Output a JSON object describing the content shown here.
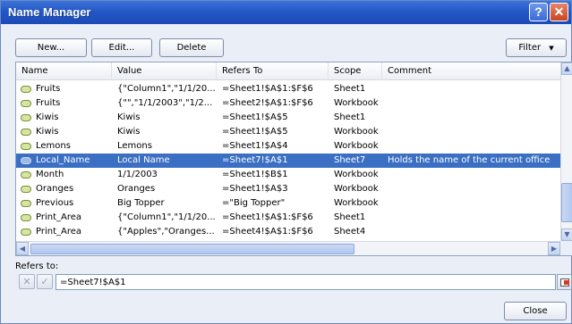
{
  "window": {
    "title": "Name Manager"
  },
  "toolbar": {
    "new_label": "New...",
    "edit_label": "Edit...",
    "delete_label": "Delete",
    "filter_label": "Filter"
  },
  "table": {
    "headers": {
      "name": "Name",
      "value": "Value",
      "refers_to": "Refers To",
      "scope": "Scope",
      "comment": "Comment"
    },
    "rows": [
      {
        "name": "Fruits",
        "value": "{\"Column1\",\"1/1/20...",
        "refers_to": "=Sheet1!$A$1:$F$6",
        "scope": "Sheet1",
        "comment": ""
      },
      {
        "name": "Fruits",
        "value": "{\"\",\"1/1/2003\",\"1/2...",
        "refers_to": "=Sheet2!$A$1:$F$6",
        "scope": "Workbook",
        "comment": ""
      },
      {
        "name": "Kiwis",
        "value": "Kiwis",
        "refers_to": "=Sheet1!$A$5",
        "scope": "Sheet1",
        "comment": ""
      },
      {
        "name": "Kiwis",
        "value": "Kiwis",
        "refers_to": "=Sheet1!$A$5",
        "scope": "Workbook",
        "comment": ""
      },
      {
        "name": "Lemons",
        "value": "Lemons",
        "refers_to": "=Sheet1!$A$4",
        "scope": "Workbook",
        "comment": ""
      },
      {
        "name": "Local_Name",
        "value": "Local Name",
        "refers_to": "=Sheet7!$A$1",
        "scope": "Sheet7",
        "comment": "Holds the name of the current office"
      },
      {
        "name": "Month",
        "value": "1/1/2003",
        "refers_to": "=Sheet1!$B$1",
        "scope": "Workbook",
        "comment": ""
      },
      {
        "name": "Oranges",
        "value": "Oranges",
        "refers_to": "=Sheet1!$A$3",
        "scope": "Workbook",
        "comment": ""
      },
      {
        "name": "Previous",
        "value": "Big Topper",
        "refers_to": "=\"Big Topper\"",
        "scope": "Workbook",
        "comment": ""
      },
      {
        "name": "Print_Area",
        "value": "{\"Column1\",\"1/1/20...",
        "refers_to": "=Sheet1!$A$1:$F$6",
        "scope": "Sheet1",
        "comment": ""
      },
      {
        "name": "Print_Area",
        "value": "{\"Apples\",\"Oranges...",
        "refers_to": "=Sheet4!$A$1:$F$6",
        "scope": "Sheet4",
        "comment": ""
      }
    ],
    "selected_index": 5
  },
  "refers": {
    "label": "Refers to:",
    "value": "=Sheet7!$A$1"
  },
  "footer": {
    "close_label": "Close"
  },
  "icons": [
    "help-icon",
    "close-icon",
    "name-tag-icon",
    "cancel-x-icon",
    "confirm-check-icon",
    "collapse-dialog-icon",
    "dropdown-arrow-icon"
  ],
  "colors": {
    "titlebar": "#2457c6",
    "selection": "#3b6fc3",
    "dialog_bg": "#eaeef7"
  }
}
